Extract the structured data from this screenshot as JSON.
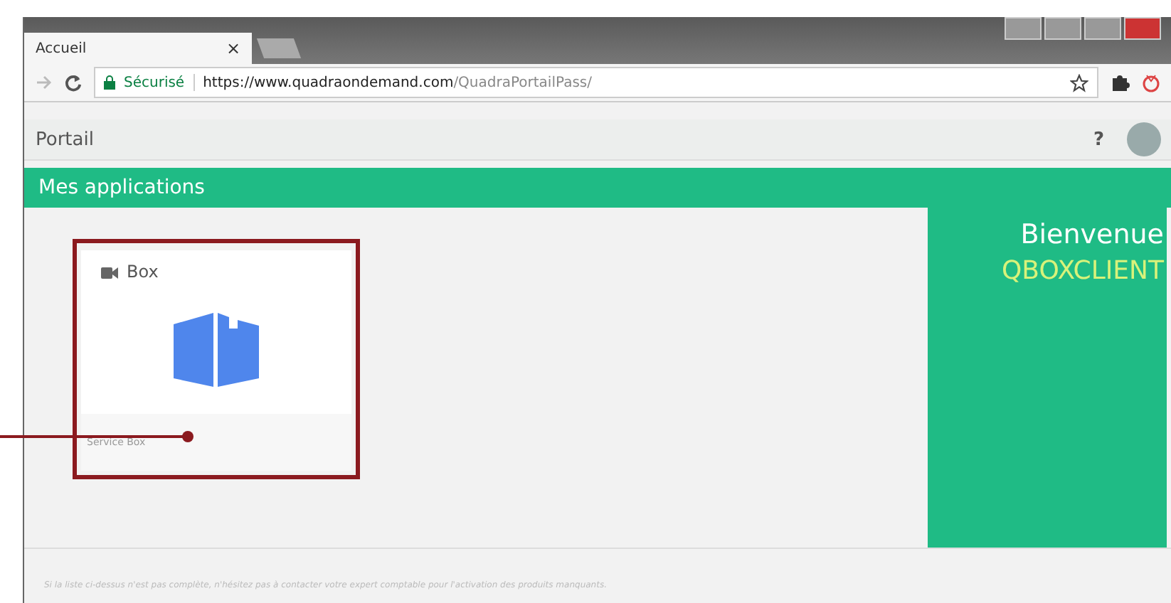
{
  "browser": {
    "tabs": [
      {
        "kind": "page",
        "label": "Accueil",
        "selected": true,
        "close": "×"
      },
      {
        "kind": "new",
        "selected": false
      }
    ],
    "address": {
      "secure_label": "Sécurisé",
      "url_host": "https://www.quadraondemand.com",
      "url_path": "/QuadraPortailPass/"
    }
  },
  "portal_bar": {
    "title": "Portail",
    "help": "?"
  },
  "header": {
    "title": "Mes applications"
  },
  "apps": [
    {
      "title": "Box",
      "footer": "Service Box",
      "highlighted": true
    }
  ],
  "welcome": {
    "greeting": "Bienvenue",
    "user": "QBOXCLIENT"
  },
  "footer_note": "Si la liste ci-dessus n'est pas complète, n'hésitez pas à contacter votre expert comptable pour l'activation des produits manquants."
}
